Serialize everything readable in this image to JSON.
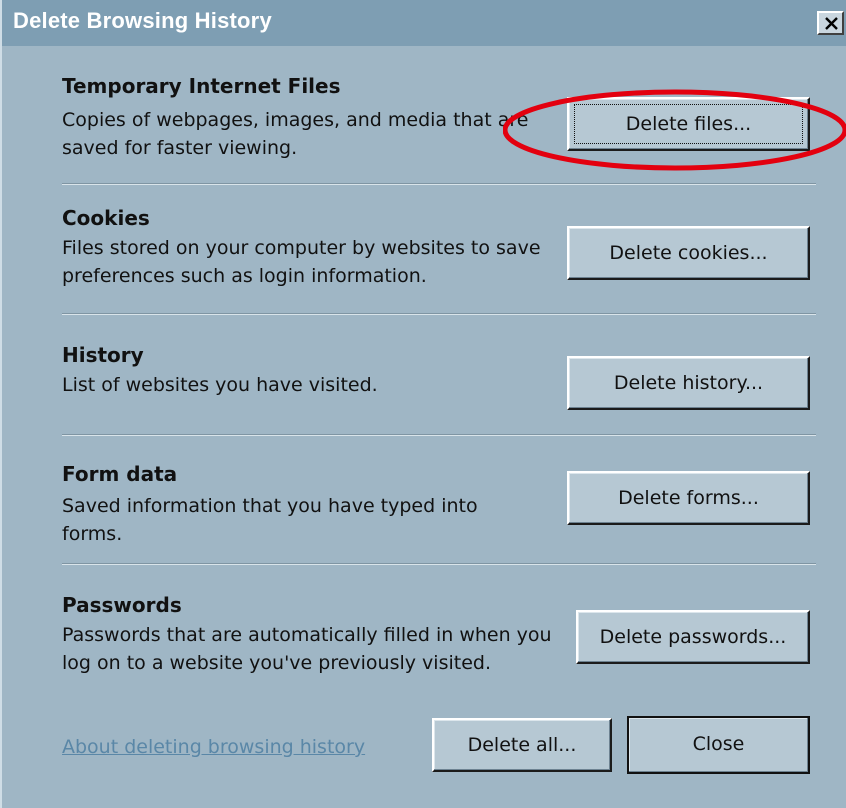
{
  "window": {
    "title": "Delete Browsing History"
  },
  "sections": [
    {
      "title": "Temporary Internet Files",
      "description": "Copies of webpages, images, and media that are saved for faster viewing.",
      "button": "Delete files..."
    },
    {
      "title": "Cookies",
      "description": "Files stored on your computer by websites to save preferences such as login information.",
      "button": "Delete cookies..."
    },
    {
      "title": "History",
      "description": "List of websites you have visited.",
      "button": "Delete history..."
    },
    {
      "title": "Form data",
      "description": "Saved information that you have typed into forms.",
      "button": "Delete forms..."
    },
    {
      "title": "Passwords",
      "description": "Passwords that are automatically filled in when you log on to a website you've previously visited.",
      "button": "Delete passwords..."
    }
  ],
  "footer": {
    "link": "About deleting browsing history",
    "delete_all": "Delete all...",
    "close": "Close"
  },
  "colors": {
    "highlight_circle": "#e3000f",
    "link": "#5a87a7",
    "title_bar": "#7e9eb3",
    "background": "#9fb6c5"
  }
}
